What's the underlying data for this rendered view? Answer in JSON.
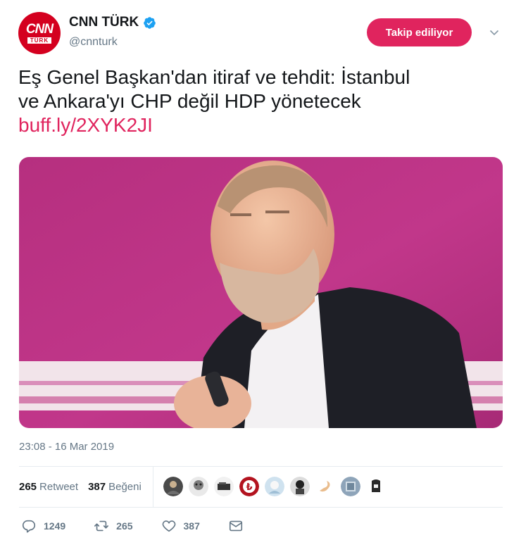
{
  "account": {
    "display_name": "CNN TÜRK",
    "handle": "@cnnturk",
    "avatar_text_top": "CNN",
    "avatar_text_bottom": "TÜRK",
    "verified": true
  },
  "follow_button": {
    "label": "Takip ediliyor"
  },
  "tweet": {
    "text_line1": "Eş Genel Başkan'dan itiraf ve tehdit: İstanbul",
    "text_line2": "ve Ankara'yı CHP değil HDP yönetecek",
    "link": "buff.ly/2XYK2JI",
    "timestamp": "23:08 - 16 Mar 2019"
  },
  "stats": {
    "retweet_count": "265",
    "retweet_label": "Retweet",
    "like_count": "387",
    "like_label": "Beğeni"
  },
  "actions": {
    "reply_count": "1249",
    "retweet_count": "265",
    "like_count": "387"
  },
  "colors": {
    "accent": "#e0245e",
    "verified": "#1da1f2",
    "muted": "#657786",
    "brand_red": "#d4001f"
  }
}
